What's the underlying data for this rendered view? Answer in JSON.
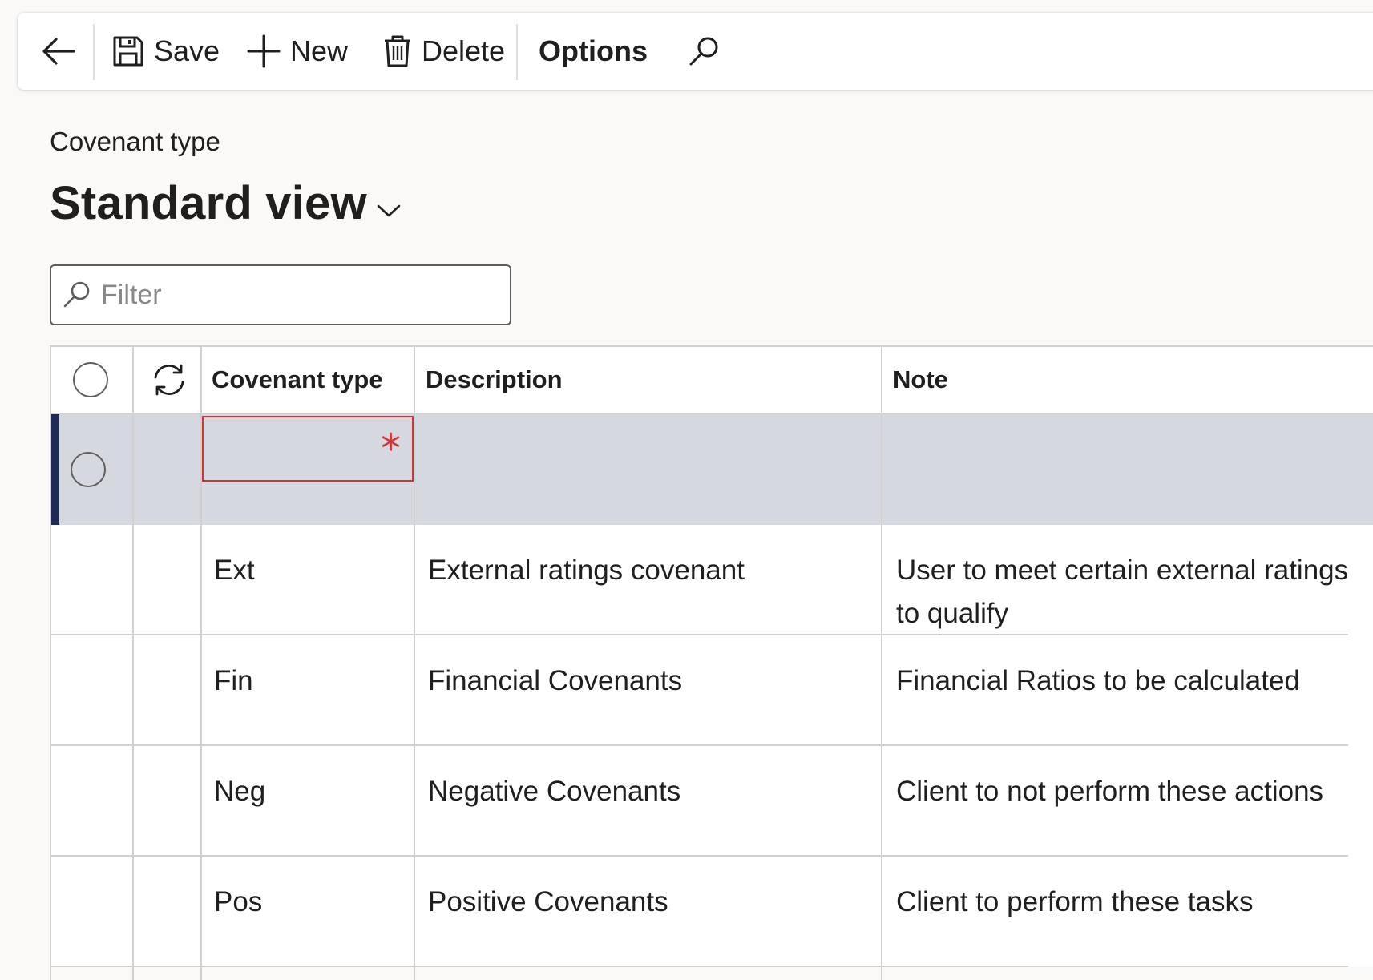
{
  "toolbar": {
    "back_label": "",
    "save_label": "Save",
    "new_label": "New",
    "delete_label": "Delete",
    "options_label": "Options",
    "icons": [
      "back-arrow-icon",
      "save-icon",
      "add-icon",
      "delete-icon",
      "search-icon"
    ]
  },
  "page": {
    "caption": "Covenant type",
    "view_name": "Standard view"
  },
  "filter": {
    "placeholder": "Filter",
    "value": ""
  },
  "grid": {
    "columns": [
      "Covenant type",
      "Description",
      "Note"
    ],
    "new_row": {
      "covenant_type": "",
      "required_marker": "*"
    },
    "rows": [
      {
        "covenant_type": "Ext",
        "description": "External ratings covenant",
        "note": "User to meet certain external ratings to qualify"
      },
      {
        "covenant_type": "Fin",
        "description": "Financial Covenants",
        "note": "Financial Ratios to be calculated"
      },
      {
        "covenant_type": "Neg",
        "description": "Negative Covenants",
        "note": "Client to not perform these actions"
      },
      {
        "covenant_type": "Pos",
        "description": "Positive Covenants",
        "note": "Client to perform these tasks"
      }
    ]
  },
  "colors": {
    "accent_navy": "#1f2a57",
    "selected_row": "#d5d8df",
    "required_red": "#d13438",
    "background": "#faf9f8"
  }
}
